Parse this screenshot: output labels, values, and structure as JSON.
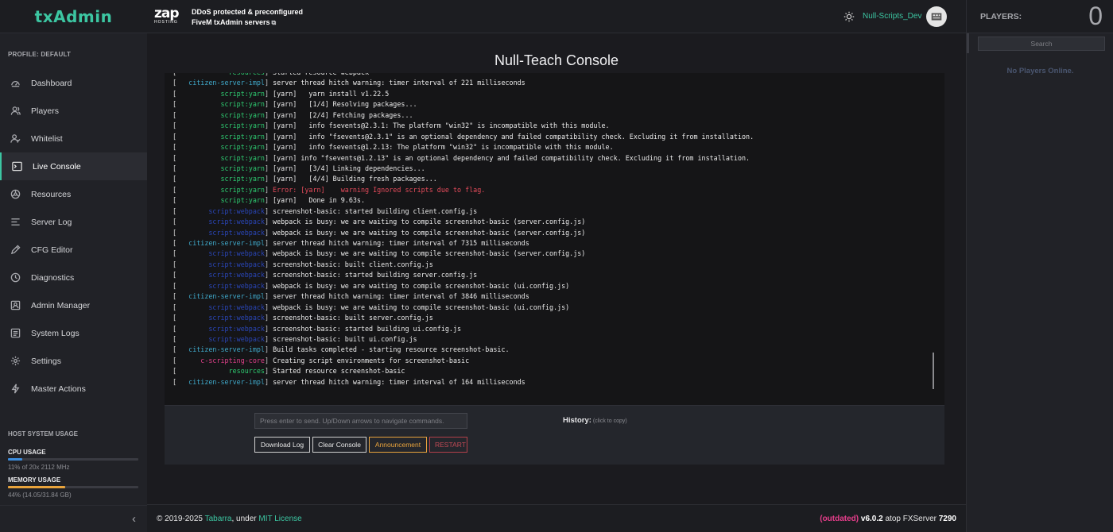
{
  "brand": {
    "name": "txAdmin",
    "accent_color": "#3cc6a2"
  },
  "sidebar": {
    "profile_label": "PROFILE: DEFAULT",
    "items": [
      {
        "label": "Dashboard",
        "icon": "dashboard-icon"
      },
      {
        "label": "Players",
        "icon": "users-icon"
      },
      {
        "label": "Whitelist",
        "icon": "user-check-icon"
      },
      {
        "label": "Live Console",
        "icon": "terminal-icon",
        "active": true
      },
      {
        "label": "Resources",
        "icon": "puzzle-icon"
      },
      {
        "label": "Server Log",
        "icon": "list-icon"
      },
      {
        "label": "CFG Editor",
        "icon": "pencil-icon"
      },
      {
        "label": "Diagnostics",
        "icon": "activity-icon"
      },
      {
        "label": "Admin Manager",
        "icon": "user-shield-icon"
      },
      {
        "label": "System Logs",
        "icon": "file-text-icon"
      },
      {
        "label": "Settings",
        "icon": "gear-icon"
      },
      {
        "label": "Master Actions",
        "icon": "bolt-icon"
      }
    ],
    "host_usage": {
      "title": "HOST SYSTEM USAGE",
      "cpu": {
        "label": "CPU USAGE",
        "percent": 11,
        "detail": "11% of 20x 2112 MHz",
        "color": "#3c8dde"
      },
      "memory": {
        "label": "MEMORY USAGE",
        "percent": 44,
        "detail": "44% (14.05/31.84 GB)",
        "color": "#e8a33c"
      }
    },
    "collapse_icon": "chevron-left-icon",
    "collapse_glyph": "‹"
  },
  "header": {
    "logo_text": "zap",
    "logo_sub": "HOSTING",
    "promo_line1": "DDoS protected & preconfigured",
    "promo_line2": "FiveM txAdmin servers",
    "ext_glyph": "⧉",
    "username": "Null-Scripts_Dev"
  },
  "main": {
    "title": "Null-Teach Console",
    "console": {
      "lines": [
        {
          "tag": "resources",
          "tag_class": "tag-green",
          "text": "Started resource webpack"
        },
        {
          "tag": "citizen-server-impl",
          "tag_class": "tag-teal",
          "text": "server thread hitch warning: timer interval of 221 milliseconds"
        },
        {
          "tag": "script:yarn",
          "tag_class": "tag-green",
          "text": "[yarn]   yarn install v1.22.5"
        },
        {
          "tag": "script:yarn",
          "tag_class": "tag-green",
          "text": "[yarn]   [1/4] Resolving packages..."
        },
        {
          "tag": "script:yarn",
          "tag_class": "tag-green",
          "text": "[yarn]   [2/4] Fetching packages..."
        },
        {
          "tag": "script:yarn",
          "tag_class": "tag-green",
          "text": "[yarn]   info fsevents@2.3.1: The platform \"win32\" is incompatible with this module."
        },
        {
          "tag": "script:yarn",
          "tag_class": "tag-green",
          "text": "[yarn]   info \"fsevents@2.3.1\" is an optional dependency and failed compatibility check. Excluding it from installation."
        },
        {
          "tag": "script:yarn",
          "tag_class": "tag-green",
          "text": "[yarn]   info fsevents@1.2.13: The platform \"win32\" is incompatible with this module."
        },
        {
          "tag": "script:yarn",
          "tag_class": "tag-green",
          "text": "[yarn] info \"fsevents@1.2.13\" is an optional dependency and failed compatibility check. Excluding it from installation."
        },
        {
          "tag": "script:yarn",
          "tag_class": "tag-green",
          "text": "[yarn]   [3/4] Linking dependencies..."
        },
        {
          "tag": "script:yarn",
          "tag_class": "tag-green",
          "text": "[yarn]   [4/4] Building fresh packages..."
        },
        {
          "tag": "script:yarn",
          "tag_class": "tag-green",
          "text": "Error: [yarn]    warning Ignored scripts due to flag.",
          "text_class": "txt-red"
        },
        {
          "tag": "script:yarn",
          "tag_class": "tag-green",
          "text": "[yarn]   Done in 9.63s."
        },
        {
          "tag": "script:webpack",
          "tag_class": "tag-blue",
          "text": "screenshot-basic: started building client.config.js"
        },
        {
          "tag": "script:webpack",
          "tag_class": "tag-blue",
          "text": "webpack is busy: we are waiting to compile screenshot-basic (server.config.js)"
        },
        {
          "tag": "script:webpack",
          "tag_class": "tag-blue",
          "text": "webpack is busy: we are waiting to compile screenshot-basic (server.config.js)"
        },
        {
          "tag": "citizen-server-impl",
          "tag_class": "tag-teal",
          "text": "server thread hitch warning: timer interval of 7315 milliseconds"
        },
        {
          "tag": "script:webpack",
          "tag_class": "tag-blue",
          "text": "webpack is busy: we are waiting to compile screenshot-basic (server.config.js)"
        },
        {
          "tag": "script:webpack",
          "tag_class": "tag-blue",
          "text": "screenshot-basic: built client.config.js"
        },
        {
          "tag": "script:webpack",
          "tag_class": "tag-blue",
          "text": "screenshot-basic: started building server.config.js"
        },
        {
          "tag": "script:webpack",
          "tag_class": "tag-blue",
          "text": "webpack is busy: we are waiting to compile screenshot-basic (ui.config.js)"
        },
        {
          "tag": "citizen-server-impl",
          "tag_class": "tag-teal",
          "text": "server thread hitch warning: timer interval of 3846 milliseconds"
        },
        {
          "tag": "script:webpack",
          "tag_class": "tag-blue",
          "text": "webpack is busy: we are waiting to compile screenshot-basic (ui.config.js)"
        },
        {
          "tag": "script:webpack",
          "tag_class": "tag-blue",
          "text": "screenshot-basic: built server.config.js"
        },
        {
          "tag": "script:webpack",
          "tag_class": "tag-blue",
          "text": "screenshot-basic: started building ui.config.js"
        },
        {
          "tag": "script:webpack",
          "tag_class": "tag-blue",
          "text": "screenshot-basic: built ui.config.js"
        },
        {
          "tag": "citizen-server-impl",
          "tag_class": "tag-teal",
          "text": "Build tasks completed - starting resource screenshot-basic."
        },
        {
          "tag": "c-scripting-core",
          "tag_class": "tag-pink",
          "text": "Creating script environments for screenshot-basic"
        },
        {
          "tag": "resources",
          "tag_class": "tag-green",
          "text": "Started resource screenshot-basic"
        },
        {
          "tag": "citizen-server-impl",
          "tag_class": "tag-teal",
          "text": "server thread hitch warning: timer interval of 164 milliseconds"
        }
      ],
      "input_placeholder": "Press enter to send. Up/Down arrows to navigate commands.",
      "history_label": "History:",
      "history_hint": "(click to copy)",
      "buttons": {
        "download": "Download Log",
        "clear": "Clear Console",
        "announce": "Announcement",
        "restart": "RESTART"
      }
    }
  },
  "footer": {
    "copyright_prefix": "© 2019-2025 ",
    "author": "Tabarra",
    "under": ", under ",
    "license": "MIT License",
    "outdated": "(outdated)",
    "version": " v6.0.2",
    "atop": " atop FXServer ",
    "fxserver_build": "7290"
  },
  "players": {
    "label": "PLAYERS:",
    "count": "0",
    "search_placeholder": "Search",
    "empty_text": "No Players Online."
  }
}
